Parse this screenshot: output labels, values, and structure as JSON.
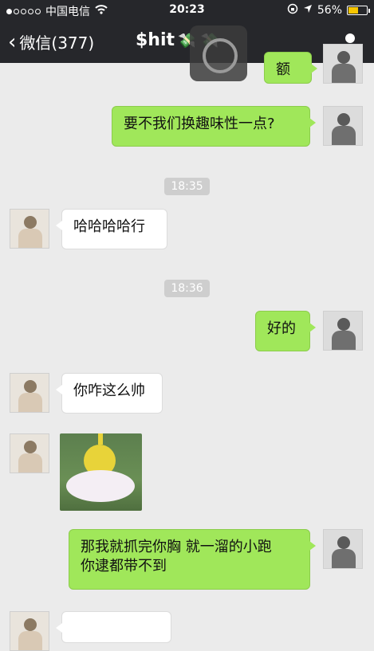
{
  "status_bar": {
    "carrier": "中国电信",
    "time": "20:23",
    "battery": "56%",
    "battery_level": 0.56,
    "signal_bars_filled": 1
  },
  "nav": {
    "back_label": "微信(377)",
    "title": "$hit",
    "title_emoji": "💸 💸"
  },
  "messages": {
    "m0": "额",
    "m1": "要不我们换趣味性一点?",
    "t1": "18:35",
    "m2": "哈哈哈哈行",
    "t2": "18:36",
    "m3": "好的",
    "m4": "你咋这么帅",
    "m5_line1": "那我就抓完你胸 就一溜的小跑",
    "m5_line2": "你逮都带不到"
  },
  "colors": {
    "my_bubble": "#a0e75a",
    "their_bubble": "#ffffff",
    "bar_bg": "#26272b",
    "chat_bg": "#ebebeb"
  }
}
